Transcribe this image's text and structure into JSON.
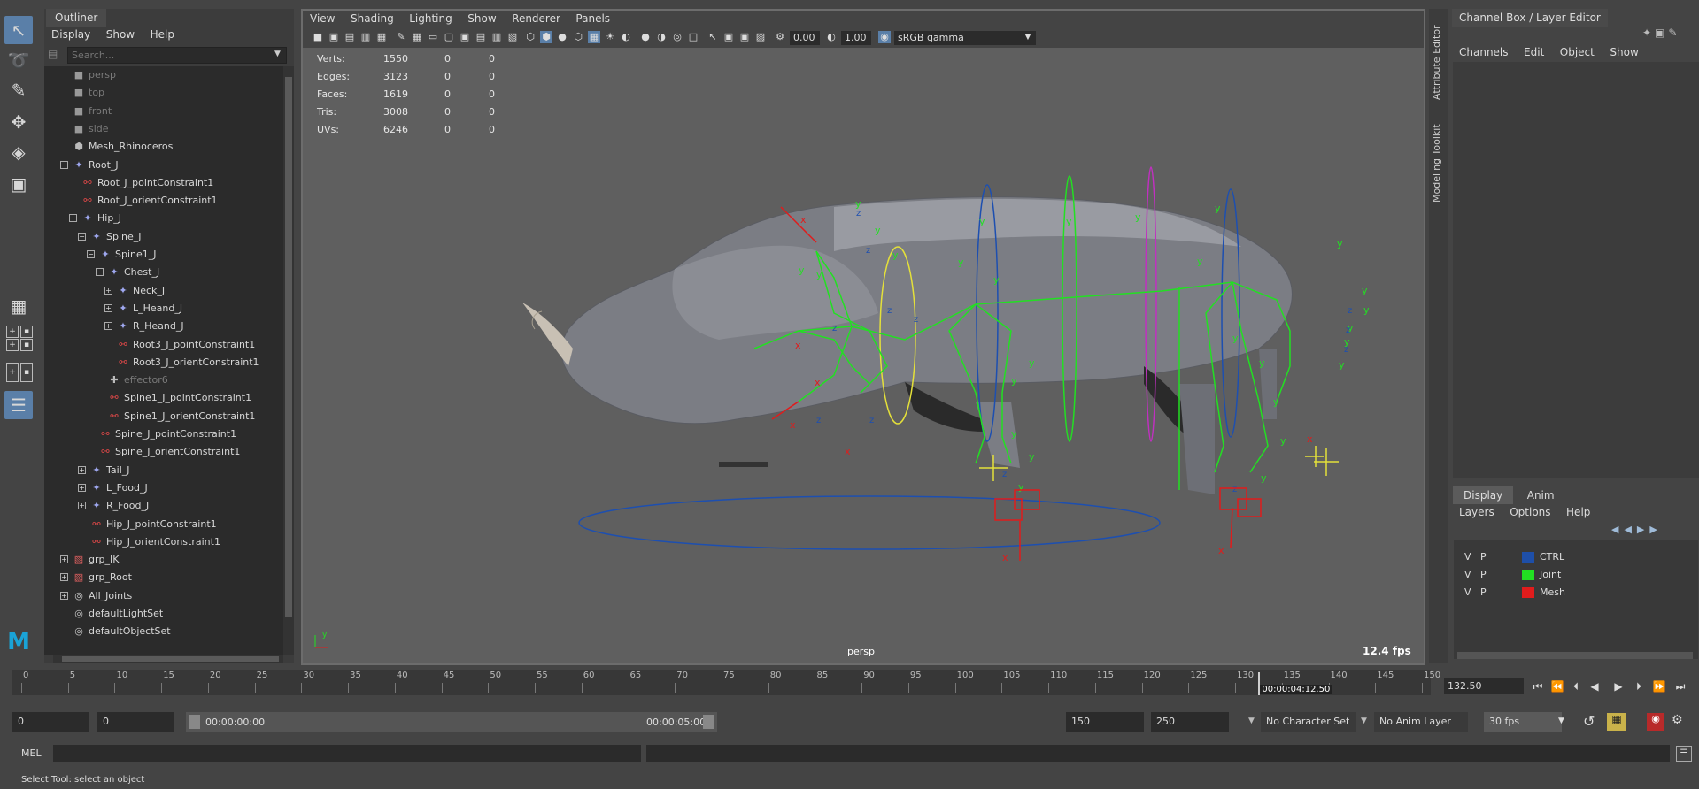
{
  "toolbox": {
    "tools": [
      "select-tool-icon",
      "lasso-tool-icon",
      "paint-tool-icon",
      "move-tool-icon",
      "rotate-tool-icon",
      "scale-tool-icon"
    ],
    "logo": "M"
  },
  "outliner": {
    "tab": "Outliner",
    "menus": [
      "Display",
      "Show",
      "Help"
    ],
    "search_placeholder": "Search...",
    "items": [
      {
        "label": "persp",
        "indent": 0,
        "dim": true,
        "icon": "camera-icon"
      },
      {
        "label": "top",
        "indent": 0,
        "dim": true,
        "icon": "camera-icon"
      },
      {
        "label": "front",
        "indent": 0,
        "dim": true,
        "icon": "camera-icon"
      },
      {
        "label": "side",
        "indent": 0,
        "dim": true,
        "icon": "camera-icon"
      },
      {
        "label": "Mesh_Rhinoceros",
        "indent": 0,
        "dim": false,
        "icon": "mesh-icon"
      },
      {
        "label": "Root_J",
        "indent": 0,
        "dim": false,
        "icon": "joint-icon",
        "expander": "minus"
      },
      {
        "label": "Root_J_pointConstraint1",
        "indent": 1,
        "dim": false,
        "icon": "constraint-icon"
      },
      {
        "label": "Root_J_orientConstraint1",
        "indent": 1,
        "dim": false,
        "icon": "constraint-icon"
      },
      {
        "label": "Hip_J",
        "indent": 1,
        "dim": false,
        "icon": "joint-icon",
        "expander": "minus"
      },
      {
        "label": "Spine_J",
        "indent": 2,
        "dim": false,
        "icon": "joint-icon",
        "expander": "minus"
      },
      {
        "label": "Spine1_J",
        "indent": 3,
        "dim": false,
        "icon": "joint-icon",
        "expander": "minus"
      },
      {
        "label": "Chest_J",
        "indent": 4,
        "dim": false,
        "icon": "joint-icon",
        "expander": "minus"
      },
      {
        "label": "Neck_J",
        "indent": 5,
        "dim": false,
        "icon": "joint-icon",
        "expander": "plus"
      },
      {
        "label": "L_Heand_J",
        "indent": 5,
        "dim": false,
        "icon": "joint-icon",
        "expander": "plus"
      },
      {
        "label": "R_Heand_J",
        "indent": 5,
        "dim": false,
        "icon": "joint-icon",
        "expander": "plus"
      },
      {
        "label": "Root3_J_pointConstraint1",
        "indent": 5,
        "dim": false,
        "icon": "constraint-icon"
      },
      {
        "label": "Root3_J_orientConstraint1",
        "indent": 5,
        "dim": false,
        "icon": "constraint-icon"
      },
      {
        "label": "effector6",
        "indent": 4,
        "dim": true,
        "icon": "effector-icon"
      },
      {
        "label": "Spine1_J_pointConstraint1",
        "indent": 4,
        "dim": false,
        "icon": "constraint-icon"
      },
      {
        "label": "Spine1_J_orientConstraint1",
        "indent": 4,
        "dim": false,
        "icon": "constraint-icon"
      },
      {
        "label": "Spine_J_pointConstraint1",
        "indent": 3,
        "dim": false,
        "icon": "constraint-icon"
      },
      {
        "label": "Spine_J_orientConstraint1",
        "indent": 3,
        "dim": false,
        "icon": "constraint-icon"
      },
      {
        "label": "Tail_J",
        "indent": 2,
        "dim": false,
        "icon": "joint-icon",
        "expander": "plus"
      },
      {
        "label": "L_Food_J",
        "indent": 2,
        "dim": false,
        "icon": "joint-icon",
        "expander": "plus"
      },
      {
        "label": "R_Food_J",
        "indent": 2,
        "dim": false,
        "icon": "joint-icon",
        "expander": "plus"
      },
      {
        "label": "Hip_J_pointConstraint1",
        "indent": 2,
        "dim": false,
        "icon": "constraint-icon"
      },
      {
        "label": "Hip_J_orientConstraint1",
        "indent": 2,
        "dim": false,
        "icon": "constraint-icon"
      },
      {
        "label": "grp_IK",
        "indent": 0,
        "dim": false,
        "icon": "group-icon",
        "expander": "plus"
      },
      {
        "label": "grp_Root",
        "indent": 0,
        "dim": false,
        "icon": "group-icon",
        "expander": "plus"
      },
      {
        "label": "All_Joints",
        "indent": 0,
        "dim": false,
        "icon": "set-icon",
        "expander": "plus"
      },
      {
        "label": "defaultLightSet",
        "indent": 0,
        "dim": false,
        "icon": "set-icon"
      },
      {
        "label": "defaultObjectSet",
        "indent": 0,
        "dim": false,
        "icon": "set-icon"
      }
    ]
  },
  "viewport": {
    "menus": [
      "View",
      "Shading",
      "Lighting",
      "Show",
      "Renderer",
      "Panels"
    ],
    "exposure": "0.00",
    "gamma": "1.00",
    "colorspace": "sRGB gamma",
    "hud": [
      {
        "label": "Verts:",
        "v1": "1550",
        "v2": "0",
        "v3": "0"
      },
      {
        "label": "Edges:",
        "v1": "3123",
        "v2": "0",
        "v3": "0"
      },
      {
        "label": "Faces:",
        "v1": "1619",
        "v2": "0",
        "v3": "0"
      },
      {
        "label": "Tris:",
        "v1": "3008",
        "v2": "0",
        "v3": "0"
      },
      {
        "label": "UVs:",
        "v1": "6246",
        "v2": "0",
        "v3": "0"
      }
    ],
    "camera": "persp",
    "fps": "12.4 fps"
  },
  "sidebar": {
    "vtabs": [
      "Attribute Editor",
      "Modeling Toolkit"
    ]
  },
  "channel_box": {
    "tab": "Channel Box / Layer Editor",
    "menus": [
      "Channels",
      "Edit",
      "Object",
      "Show"
    ],
    "layer_tabs": [
      "Display",
      "Anim"
    ],
    "layer_menus": [
      "Layers",
      "Options",
      "Help"
    ],
    "layers": [
      {
        "v": "V",
        "p": "P",
        "name": "CTRL",
        "color": "#1e4fa8"
      },
      {
        "v": "V",
        "p": "P",
        "name": "Joint",
        "color": "#22e022"
      },
      {
        "v": "V",
        "p": "P",
        "name": "Mesh",
        "color": "#e01c1c"
      }
    ]
  },
  "timeline": {
    "ticks": [
      "0",
      "5",
      "10",
      "15",
      "20",
      "25",
      "30",
      "35",
      "40",
      "45",
      "50",
      "55",
      "60",
      "65",
      "70",
      "75",
      "80",
      "85",
      "90",
      "95",
      "100",
      "105",
      "110",
      "115",
      "120",
      "125",
      "130",
      "135",
      "140",
      "145",
      "150"
    ],
    "current_time": "00:00:04:12.50",
    "current_frame": "132.50",
    "current_frame_value": 132.5,
    "max_frame": 150
  },
  "range": {
    "start": "0",
    "playback_start": "0",
    "slider_start": "00:00:00:00",
    "slider_end": "00:00:05:00",
    "playback_end": "150",
    "end": "250",
    "character_set": "No Character Set",
    "anim_layer": "No Anim Layer",
    "fps": "30 fps"
  },
  "command_line": {
    "label": "MEL"
  },
  "status": "Select Tool: select an object"
}
